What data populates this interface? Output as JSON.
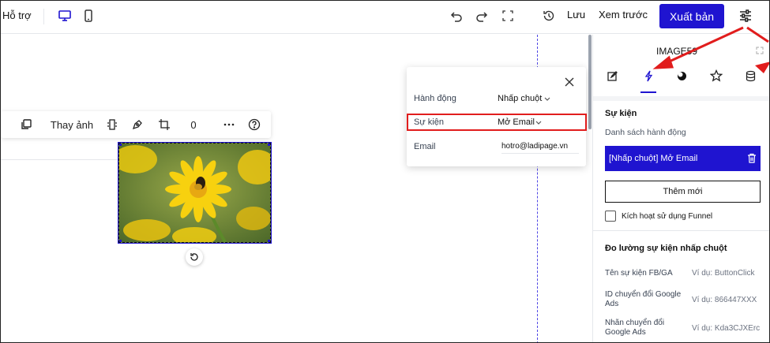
{
  "topbar": {
    "help_label": "Hỗ trợ",
    "save_label": "Lưu",
    "preview_label": "Xem trước",
    "publish_label": "Xuất bản"
  },
  "image_toolbar": {
    "change_image_label": "Thay ảnh",
    "rotation_value": "0"
  },
  "action_popup": {
    "rows": [
      {
        "label": "Hành động",
        "value": "Nhấp chuột"
      },
      {
        "label": "Sự kiện",
        "value": "Mở Email"
      },
      {
        "label": "Email",
        "value": "hotro@ladipage.vn"
      }
    ]
  },
  "panel": {
    "title": "IMAGE59",
    "events_heading": "Sự kiện",
    "action_list_label": "Danh sách hành động",
    "action_item_label": "[Nhấp chuột] Mở Email",
    "add_new_label": "Thêm mới",
    "funnel_label": "Kích hoạt sử dụng Funnel",
    "tracking_heading": "Đo lường sự kiện nhấp chuột",
    "tracking_rows": [
      {
        "label": "Tên sự kiện FB/GA",
        "placeholder": "Ví dụ: ButtonClick"
      },
      {
        "label": "ID chuyển đổi Google Ads",
        "placeholder": "Ví dụ: 866447XXX"
      },
      {
        "label": "Nhãn chuyển đổi Google Ads",
        "placeholder": "Ví dụ: Kda3CJXErc"
      }
    ]
  },
  "colors": {
    "accent": "#1f14d0",
    "highlight": "#e11d1d"
  },
  "icons": [
    "desktop-icon",
    "mobile-icon",
    "undo-icon",
    "redo-icon",
    "fullscreen-icon",
    "history-icon",
    "settings-sliders-icon",
    "layers-icon",
    "replace-icon",
    "pen-icon",
    "crop-icon",
    "more-icon",
    "help-icon",
    "rotate-icon",
    "close-icon",
    "chevron-down-icon",
    "edit-icon",
    "lightning-icon",
    "circle-icon",
    "star-icon",
    "database-icon",
    "trash-icon",
    "expand-icon"
  ]
}
